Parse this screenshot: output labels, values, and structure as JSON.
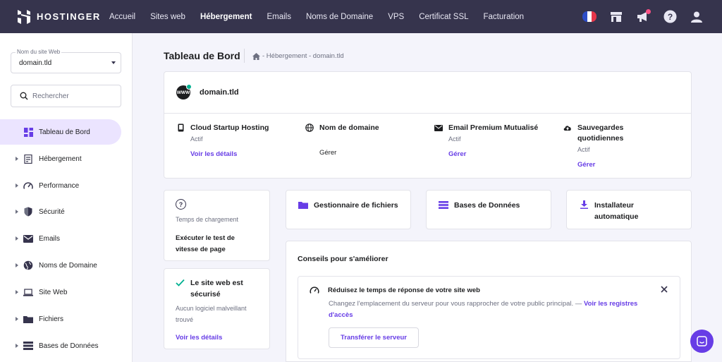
{
  "brand": {
    "name": "HOSTINGER"
  },
  "topnav": {
    "items": [
      {
        "label": "Accueil"
      },
      {
        "label": "Sites web"
      },
      {
        "label": "Hébergement",
        "active": true
      },
      {
        "label": "Emails"
      },
      {
        "label": "Noms de Domaine"
      },
      {
        "label": "VPS"
      },
      {
        "label": "Certificat SSL"
      },
      {
        "label": "Facturation"
      }
    ],
    "icons": [
      "france-flag-icon",
      "store-icon",
      "megaphone-icon",
      "help-icon",
      "account-icon"
    ]
  },
  "sidebar": {
    "site_select": {
      "label": "Nom du site Web",
      "value": "domain.tld"
    },
    "search": {
      "placeholder": "Rechercher"
    },
    "items": [
      {
        "label": "Tableau de Bord",
        "icon": "dashboard-icon",
        "active": true
      },
      {
        "label": "Hébergement",
        "icon": "server-icon"
      },
      {
        "label": "Performance",
        "icon": "gauge-icon"
      },
      {
        "label": "Sécurité",
        "icon": "shield-icon"
      },
      {
        "label": "Emails",
        "icon": "mail-icon"
      },
      {
        "label": "Noms de Domaine",
        "icon": "globe-icon"
      },
      {
        "label": "Site Web",
        "icon": "laptop-icon"
      },
      {
        "label": "Fichiers",
        "icon": "folder-icon"
      },
      {
        "label": "Bases de Données",
        "icon": "database-icon"
      }
    ]
  },
  "header": {
    "title": "Tableau de Bord",
    "breadcrumb": "- Hébergement - domain.tld"
  },
  "domain_card": {
    "domain": "domain.tld",
    "logo_text": "WWW",
    "services": [
      {
        "title": "Cloud Startup Hosting",
        "status": "Actif",
        "link": "Voir les détails",
        "icon": "phone-icon"
      },
      {
        "title": "Nom de domaine",
        "status": "",
        "link": "Gérer",
        "icon": "globe-icon"
      },
      {
        "title": "Email Premium Mutualisé",
        "status": "Actif",
        "link": "Gérer",
        "icon": "mail-icon"
      },
      {
        "title": "Sauvegardes quotidiennes",
        "status": "Actif",
        "link": "Gérer",
        "icon": "cloud-upload-icon"
      }
    ]
  },
  "speed_card": {
    "subtitle": "Temps de chargement",
    "link": "Exécuter le test de vitesse de page"
  },
  "secure_card": {
    "title": "Le site web est sécurisé",
    "subtitle": "Aucun logiciel malveillant trouvé",
    "link": "Voir les détails"
  },
  "tools": [
    {
      "label": "Gestionnaire de fichiers",
      "icon": "folder-icon"
    },
    {
      "label": "Bases de Données",
      "icon": "database-icon"
    },
    {
      "label": "Installateur automatique",
      "icon": "download-icon"
    }
  ],
  "tips": {
    "title": "Conseils pour s'améliorer",
    "tip_title": "Réduisez le temps de réponse de votre site web",
    "tip_desc": "Changez l'emplacement du serveur pour vous rapprocher de votre public principal. —",
    "tip_link": "Voir les registres d'accès",
    "button": "Transférer le serveur"
  },
  "colors": {
    "accent": "#673de6",
    "nav_bg": "#36344d",
    "active_bg": "#ebe4ff",
    "success": "#00b090"
  }
}
